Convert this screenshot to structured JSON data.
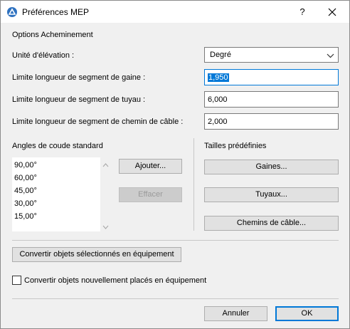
{
  "window": {
    "title": "Préférences MEP",
    "help_label": "?",
    "app_icon": "archicad-icon",
    "close_icon": "close-icon"
  },
  "routing": {
    "section_title": "Options Acheminement",
    "elevation_unit": {
      "label": "Unité d'élévation :",
      "value": "Degré"
    },
    "duct_limit": {
      "label": "Limite longueur de segment de gaine :",
      "value": "1,950"
    },
    "pipe_limit": {
      "label": "Limite longueur de segment de tuyau :",
      "value": "6,000"
    },
    "cable_limit": {
      "label": "Limite longueur de segment de chemin de câble :",
      "value": "2,000"
    }
  },
  "angles": {
    "title": "Angles de coude standard",
    "items": [
      "90,00°",
      "60,00°",
      "45,00°",
      "30,00°",
      "15,00°"
    ],
    "add_label": "Ajouter...",
    "delete_label": "Effacer"
  },
  "presets": {
    "title": "Tailles prédéfinies",
    "ducts_label": "Gaines...",
    "pipes_label": "Tuyaux...",
    "cable_label": "Chemins de câble..."
  },
  "convert": {
    "selected_label": "Convertir objets sélectionnés en équipement",
    "new_label": "Convertir objets nouvellement placés en équipement",
    "new_checked": false
  },
  "footer": {
    "cancel_label": "Annuler",
    "ok_label": "OK"
  },
  "colors": {
    "accent": "#0078d7",
    "dialog_bg": "#f0f0f0"
  }
}
